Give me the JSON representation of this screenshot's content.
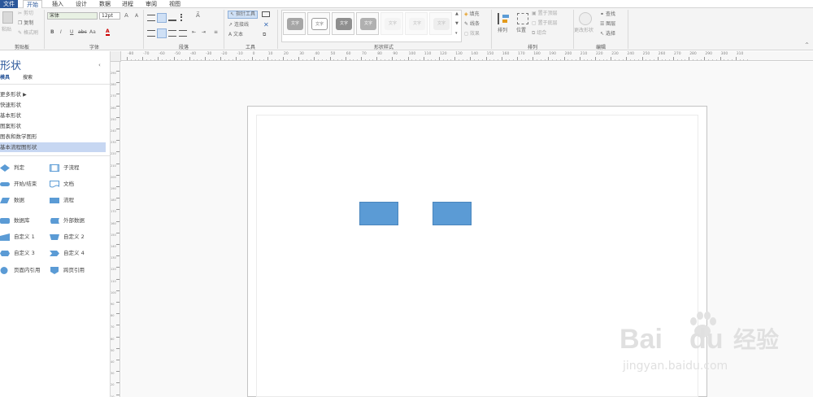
{
  "menu": {
    "tabs": [
      "文件",
      "开始",
      "插入",
      "设计",
      "数据",
      "进程",
      "审阅",
      "视图"
    ],
    "active": "开始"
  },
  "clipboard": {
    "paste": "粘贴",
    "cut": "剪切",
    "copy": "复制",
    "format_painter": "格式刷",
    "label": "剪贴板"
  },
  "font": {
    "family": "宋体",
    "size": "12pt",
    "bold": "B",
    "italic": "I",
    "underline": "U",
    "strike": "abc",
    "case": "Aa",
    "color_letter": "A",
    "grow": "A",
    "shrink": "A",
    "label": "字体"
  },
  "paragraph": {
    "label": "段落"
  },
  "tools": {
    "pointer": "指针工具",
    "connector": "连接线",
    "text": "文本",
    "label": "工具"
  },
  "shape_styles": {
    "swatch_label": "文字",
    "fill": "填充",
    "line": "线条",
    "effects": "效果",
    "label": "形状样式"
  },
  "arrange": {
    "align": "排列",
    "position": "位置",
    "bring_front": "置于顶层",
    "send_back": "置于底层",
    "group": "组合",
    "label": "排列"
  },
  "editing": {
    "change_shape": "更改形状",
    "find": "查找",
    "layers": "图层",
    "select": "选择",
    "label": "编辑"
  },
  "sidebar": {
    "title": "形状",
    "tab_stencils": "模具",
    "tab_search": "搜索",
    "more_shapes": "更多形状",
    "categories": [
      "快速形状",
      "基本形状",
      "图案形状",
      "图表和数学图形",
      "基本流程图形状"
    ],
    "selected_category": "基本流程图形状",
    "shapes": [
      {
        "label": "判定",
        "icon": "diamond-shape-icon"
      },
      {
        "label": "子流程",
        "icon": "subprocess-shape-icon"
      },
      {
        "label": "开始/结束",
        "icon": "terminator-shape-icon"
      },
      {
        "label": "文档",
        "icon": "document-shape-icon"
      },
      {
        "label": "数据",
        "icon": "parallelogram-shape-icon"
      },
      {
        "label": "流程",
        "icon": "process-shape-icon"
      },
      {
        "label": "数据库",
        "icon": "database-shape-icon"
      },
      {
        "label": "外部数据",
        "icon": "external-data-shape-icon"
      },
      {
        "label": "自定义 1",
        "icon": "custom1-shape-icon"
      },
      {
        "label": "自定义 2",
        "icon": "custom2-shape-icon"
      },
      {
        "label": "自定义 3",
        "icon": "custom3-shape-icon"
      },
      {
        "label": "自定义 4",
        "icon": "custom4-shape-icon"
      },
      {
        "label": "页面内引用",
        "icon": "on-page-reference-icon"
      },
      {
        "label": "跨页引用",
        "icon": "off-page-reference-icon"
      }
    ]
  },
  "ruler": {
    "h_ticks": [
      "-80",
      "-70",
      "-60",
      "-50",
      "-40",
      "-30",
      "-20",
      "-10",
      "0",
      "10",
      "20",
      "30",
      "40",
      "50",
      "60",
      "70",
      "80",
      "90",
      "100",
      "110",
      "120",
      "130",
      "140",
      "150",
      "160",
      "170",
      "180",
      "190",
      "200",
      "210",
      "220",
      "230",
      "240",
      "250",
      "260",
      "270",
      "280",
      "290",
      "300",
      "310"
    ],
    "v_ticks": [
      "290",
      "280",
      "270",
      "260",
      "250",
      "240",
      "230",
      "220",
      "210",
      "200",
      "190",
      "180",
      "170",
      "160",
      "150",
      "140",
      "130",
      "120",
      "110",
      "100",
      "90",
      "80",
      "70",
      "60",
      "50",
      "40",
      "30",
      "20",
      "10",
      "0"
    ]
  },
  "watermark": {
    "brand": "Bai",
    "brand2": "du",
    "cn": "经验",
    "url": "jingyan.baidu.com"
  },
  "colors": {
    "accent": "#2b579a",
    "shape_fill": "#5b9bd5",
    "selected_category_bg": "#c7d7f2"
  }
}
